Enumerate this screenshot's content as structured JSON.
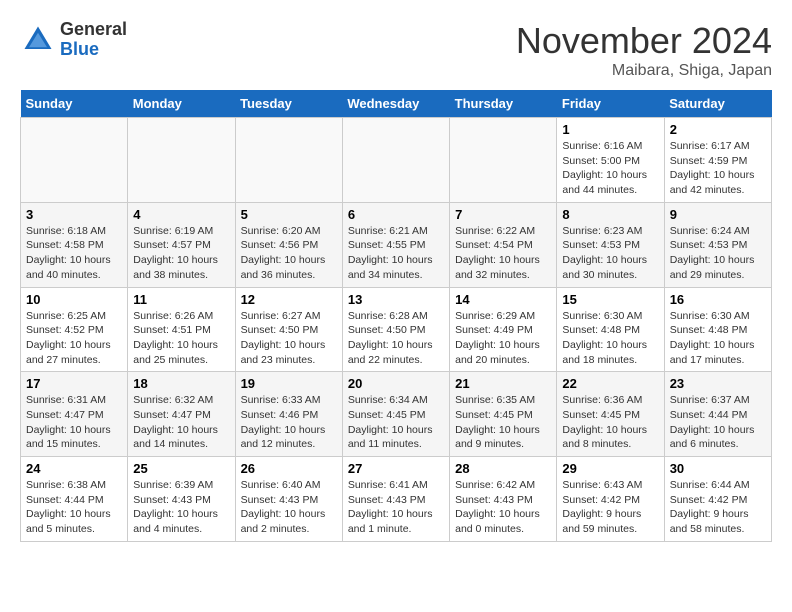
{
  "header": {
    "logo_general": "General",
    "logo_blue": "Blue",
    "month_title": "November 2024",
    "location": "Maibara, Shiga, Japan"
  },
  "days_of_week": [
    "Sunday",
    "Monday",
    "Tuesday",
    "Wednesday",
    "Thursday",
    "Friday",
    "Saturday"
  ],
  "weeks": [
    [
      {
        "day": "",
        "empty": true
      },
      {
        "day": "",
        "empty": true
      },
      {
        "day": "",
        "empty": true
      },
      {
        "day": "",
        "empty": true
      },
      {
        "day": "",
        "empty": true
      },
      {
        "day": "1",
        "sunrise": "Sunrise: 6:16 AM",
        "sunset": "Sunset: 5:00 PM",
        "daylight": "Daylight: 10 hours and 44 minutes."
      },
      {
        "day": "2",
        "sunrise": "Sunrise: 6:17 AM",
        "sunset": "Sunset: 4:59 PM",
        "daylight": "Daylight: 10 hours and 42 minutes."
      }
    ],
    [
      {
        "day": "3",
        "sunrise": "Sunrise: 6:18 AM",
        "sunset": "Sunset: 4:58 PM",
        "daylight": "Daylight: 10 hours and 40 minutes."
      },
      {
        "day": "4",
        "sunrise": "Sunrise: 6:19 AM",
        "sunset": "Sunset: 4:57 PM",
        "daylight": "Daylight: 10 hours and 38 minutes."
      },
      {
        "day": "5",
        "sunrise": "Sunrise: 6:20 AM",
        "sunset": "Sunset: 4:56 PM",
        "daylight": "Daylight: 10 hours and 36 minutes."
      },
      {
        "day": "6",
        "sunrise": "Sunrise: 6:21 AM",
        "sunset": "Sunset: 4:55 PM",
        "daylight": "Daylight: 10 hours and 34 minutes."
      },
      {
        "day": "7",
        "sunrise": "Sunrise: 6:22 AM",
        "sunset": "Sunset: 4:54 PM",
        "daylight": "Daylight: 10 hours and 32 minutes."
      },
      {
        "day": "8",
        "sunrise": "Sunrise: 6:23 AM",
        "sunset": "Sunset: 4:53 PM",
        "daylight": "Daylight: 10 hours and 30 minutes."
      },
      {
        "day": "9",
        "sunrise": "Sunrise: 6:24 AM",
        "sunset": "Sunset: 4:53 PM",
        "daylight": "Daylight: 10 hours and 29 minutes."
      }
    ],
    [
      {
        "day": "10",
        "sunrise": "Sunrise: 6:25 AM",
        "sunset": "Sunset: 4:52 PM",
        "daylight": "Daylight: 10 hours and 27 minutes."
      },
      {
        "day": "11",
        "sunrise": "Sunrise: 6:26 AM",
        "sunset": "Sunset: 4:51 PM",
        "daylight": "Daylight: 10 hours and 25 minutes."
      },
      {
        "day": "12",
        "sunrise": "Sunrise: 6:27 AM",
        "sunset": "Sunset: 4:50 PM",
        "daylight": "Daylight: 10 hours and 23 minutes."
      },
      {
        "day": "13",
        "sunrise": "Sunrise: 6:28 AM",
        "sunset": "Sunset: 4:50 PM",
        "daylight": "Daylight: 10 hours and 22 minutes."
      },
      {
        "day": "14",
        "sunrise": "Sunrise: 6:29 AM",
        "sunset": "Sunset: 4:49 PM",
        "daylight": "Daylight: 10 hours and 20 minutes."
      },
      {
        "day": "15",
        "sunrise": "Sunrise: 6:30 AM",
        "sunset": "Sunset: 4:48 PM",
        "daylight": "Daylight: 10 hours and 18 minutes."
      },
      {
        "day": "16",
        "sunrise": "Sunrise: 6:30 AM",
        "sunset": "Sunset: 4:48 PM",
        "daylight": "Daylight: 10 hours and 17 minutes."
      }
    ],
    [
      {
        "day": "17",
        "sunrise": "Sunrise: 6:31 AM",
        "sunset": "Sunset: 4:47 PM",
        "daylight": "Daylight: 10 hours and 15 minutes."
      },
      {
        "day": "18",
        "sunrise": "Sunrise: 6:32 AM",
        "sunset": "Sunset: 4:47 PM",
        "daylight": "Daylight: 10 hours and 14 minutes."
      },
      {
        "day": "19",
        "sunrise": "Sunrise: 6:33 AM",
        "sunset": "Sunset: 4:46 PM",
        "daylight": "Daylight: 10 hours and 12 minutes."
      },
      {
        "day": "20",
        "sunrise": "Sunrise: 6:34 AM",
        "sunset": "Sunset: 4:45 PM",
        "daylight": "Daylight: 10 hours and 11 minutes."
      },
      {
        "day": "21",
        "sunrise": "Sunrise: 6:35 AM",
        "sunset": "Sunset: 4:45 PM",
        "daylight": "Daylight: 10 hours and 9 minutes."
      },
      {
        "day": "22",
        "sunrise": "Sunrise: 6:36 AM",
        "sunset": "Sunset: 4:45 PM",
        "daylight": "Daylight: 10 hours and 8 minutes."
      },
      {
        "day": "23",
        "sunrise": "Sunrise: 6:37 AM",
        "sunset": "Sunset: 4:44 PM",
        "daylight": "Daylight: 10 hours and 6 minutes."
      }
    ],
    [
      {
        "day": "24",
        "sunrise": "Sunrise: 6:38 AM",
        "sunset": "Sunset: 4:44 PM",
        "daylight": "Daylight: 10 hours and 5 minutes."
      },
      {
        "day": "25",
        "sunrise": "Sunrise: 6:39 AM",
        "sunset": "Sunset: 4:43 PM",
        "daylight": "Daylight: 10 hours and 4 minutes."
      },
      {
        "day": "26",
        "sunrise": "Sunrise: 6:40 AM",
        "sunset": "Sunset: 4:43 PM",
        "daylight": "Daylight: 10 hours and 2 minutes."
      },
      {
        "day": "27",
        "sunrise": "Sunrise: 6:41 AM",
        "sunset": "Sunset: 4:43 PM",
        "daylight": "Daylight: 10 hours and 1 minute."
      },
      {
        "day": "28",
        "sunrise": "Sunrise: 6:42 AM",
        "sunset": "Sunset: 4:43 PM",
        "daylight": "Daylight: 10 hours and 0 minutes."
      },
      {
        "day": "29",
        "sunrise": "Sunrise: 6:43 AM",
        "sunset": "Sunset: 4:42 PM",
        "daylight": "Daylight: 9 hours and 59 minutes."
      },
      {
        "day": "30",
        "sunrise": "Sunrise: 6:44 AM",
        "sunset": "Sunset: 4:42 PM",
        "daylight": "Daylight: 9 hours and 58 minutes."
      }
    ]
  ]
}
